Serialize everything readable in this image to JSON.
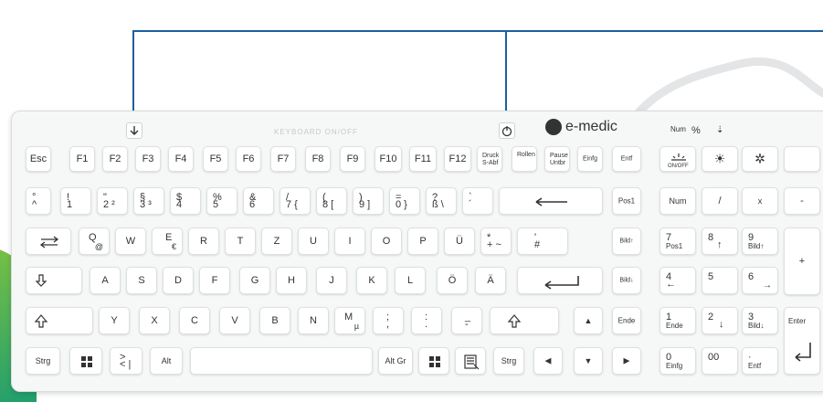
{
  "brand": {
    "name": "e-medic"
  },
  "top_strip": {
    "keyboard_toggle": "KEYBOARD ON/OFF",
    "num": "Num",
    "percent": "%",
    "scroll": "⇣"
  },
  "rows": {
    "fn": [
      "Esc",
      "F1",
      "F2",
      "F3",
      "F4",
      "F5",
      "F6",
      "F7",
      "F8",
      "F9",
      "F10",
      "F11",
      "F12"
    ],
    "fn_extra": {
      "druck_top": "Druck",
      "druck_bottom": "S-Abf",
      "rollen": "Rollen",
      "pause_top": "Pause",
      "pause_bottom": "Untbr",
      "einfg": "Einfg",
      "entf": "Entf"
    },
    "num_row": [
      {
        "top": "°",
        "bottom": "^"
      },
      {
        "top": "!",
        "bottom": "1"
      },
      {
        "top": "\"",
        "bottom": "2 ²"
      },
      {
        "top": "§",
        "bottom": "3 ³"
      },
      {
        "top": "$",
        "bottom": "4"
      },
      {
        "top": "%",
        "bottom": "5"
      },
      {
        "top": "&",
        "bottom": "6"
      },
      {
        "top": "/",
        "bottom": "7 {"
      },
      {
        "top": "(",
        "bottom": "8 ["
      },
      {
        "top": ")",
        "bottom": "9 ]"
      },
      {
        "top": "=",
        "bottom": "0 }"
      },
      {
        "top": "?",
        "bottom": "ß \\"
      },
      {
        "top": "`",
        "bottom": "´"
      }
    ],
    "q_row": [
      "Q",
      "W",
      "E",
      "R",
      "T",
      "Z",
      "U",
      "I",
      "O",
      "P",
      "Ü"
    ],
    "q_alt": {
      "q": "@",
      "e": "€",
      "plus_top": "*",
      "plus_bottom": "+ ~",
      "hash_top": "'",
      "hash_bottom": "#"
    },
    "a_row": [
      "A",
      "S",
      "D",
      "F",
      "G",
      "H",
      "J",
      "K",
      "L",
      "Ö",
      "Ä"
    ],
    "y_row": [
      "Y",
      "X",
      "C",
      "V",
      "B",
      "N",
      "M"
    ],
    "y_extra": {
      "m_alt": "µ",
      "comma_top": ";",
      "comma_bottom": ",",
      "dot_top": ":",
      "dot_bottom": ".",
      "dash_top": "_",
      "dash_bottom": "-"
    },
    "bottom": {
      "strg": "Strg",
      "lt_top": ">",
      "lt_bottom": "< |",
      "alt": "Alt",
      "altgr": "Alt Gr",
      "strg_r": "Strg"
    }
  },
  "nav": {
    "pos1": "Pos1",
    "bild_up": "Bild↑",
    "bild_down": "Bild↓",
    "ende": "Ende"
  },
  "numpad": {
    "num": "Num",
    "div": "/",
    "mul": "x",
    "minus": "-",
    "plus": "+",
    "enter": "Enter",
    "n7": "7",
    "n7b": "Pos1",
    "n8": "8",
    "n8b": "↑",
    "n9": "9",
    "n9b": "Bild↑",
    "n4": "4",
    "n4b": "←",
    "n5": "5",
    "n6": "6",
    "n6b": "→",
    "n1": "1",
    "n1b": "Ende",
    "n2": "2",
    "n2b": "↓",
    "n3": "3",
    "n3b": "Bild↓",
    "n0": "0",
    "n0b": "Einfg",
    "n00": "00",
    "dot": "·",
    "dotb": "Entf",
    "media1": "ON/OFF"
  },
  "colors": {
    "callout": "#1c5fa0",
    "key_face": "#ffffff",
    "board": "#f6f7f7"
  }
}
